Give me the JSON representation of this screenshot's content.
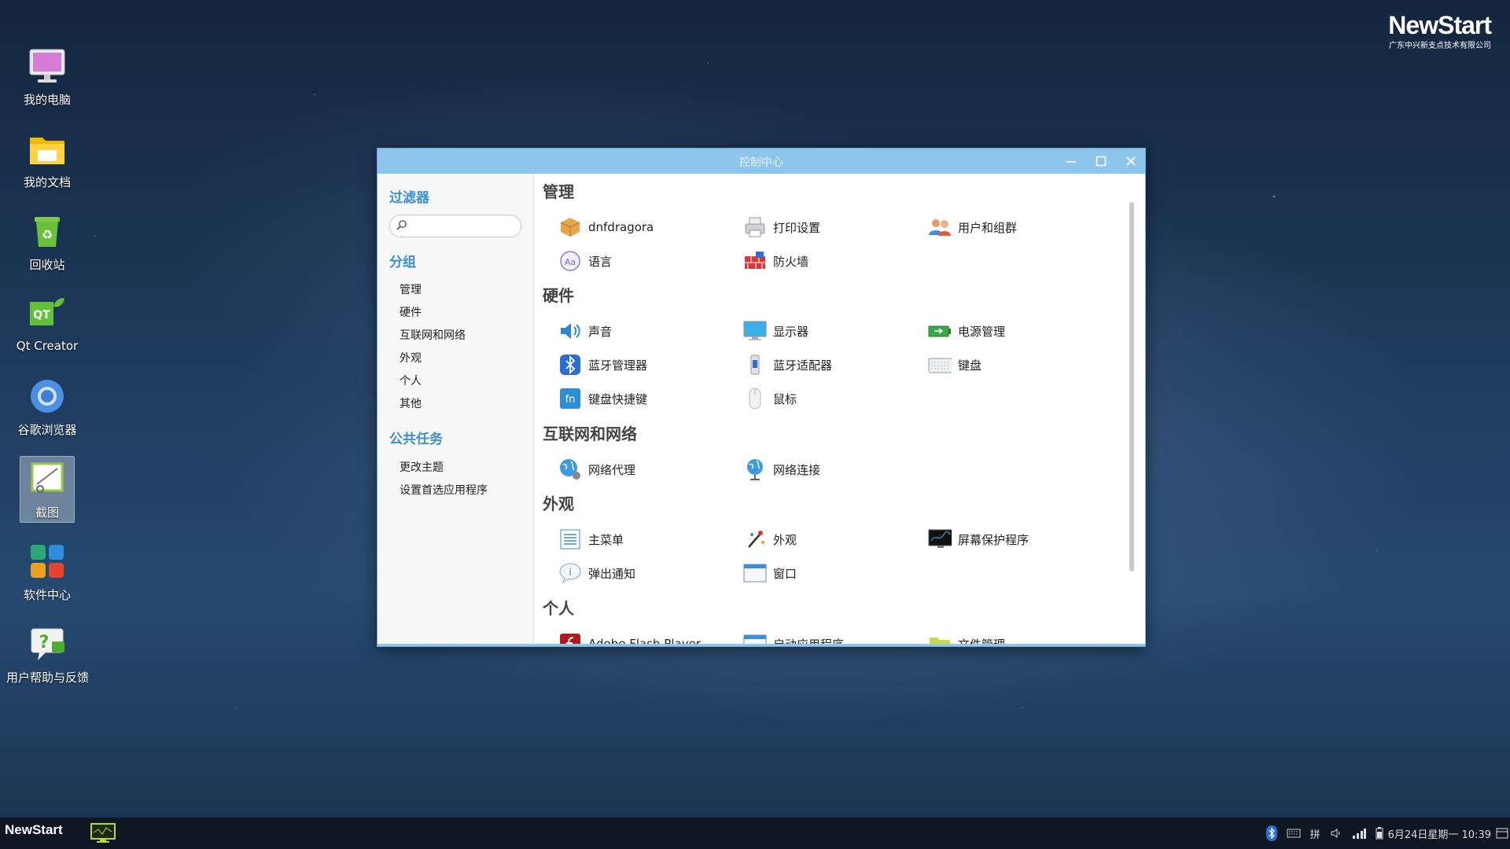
{
  "desktop": {
    "icons": [
      {
        "label": "我的电脑",
        "icon": "computer-icon"
      },
      {
        "label": "我的文档",
        "icon": "folder-icon"
      },
      {
        "label": "回收站",
        "icon": "trash-icon"
      },
      {
        "label": "Qt Creator",
        "icon": "qt-creator-icon"
      },
      {
        "label": "谷歌浏览器",
        "icon": "chrome-icon"
      },
      {
        "label": "截图",
        "icon": "screenshot-icon"
      },
      {
        "label": "软件中心",
        "icon": "software-center-icon"
      },
      {
        "label": "用户帮助与反馈",
        "icon": "help-feedback-icon"
      }
    ]
  },
  "brand": {
    "name": "NewStart",
    "subtitle": "广东中兴新支点技术有限公司"
  },
  "window": {
    "title": "控制中心",
    "sidebar": {
      "filter_title": "过滤器",
      "search_placeholder": "",
      "groups_title": "分组",
      "groups": [
        "管理",
        "硬件",
        "互联网和网络",
        "外观",
        "个人",
        "其他"
      ],
      "tasks_title": "公共任务",
      "tasks": [
        "更改主题",
        "设置首选应用程序"
      ]
    },
    "categories": [
      {
        "title": "管理",
        "items": [
          {
            "label": "dnfdragora",
            "icon": "package-icon"
          },
          {
            "label": "打印设置",
            "icon": "printer-icon"
          },
          {
            "label": "用户和组群",
            "icon": "users-icon"
          },
          {
            "label": "语言",
            "icon": "language-icon"
          },
          {
            "label": "防火墙",
            "icon": "firewall-icon"
          }
        ]
      },
      {
        "title": "硬件",
        "items": [
          {
            "label": "声音",
            "icon": "sound-icon"
          },
          {
            "label": "显示器",
            "icon": "display-icon"
          },
          {
            "label": "电源管理",
            "icon": "battery-icon"
          },
          {
            "label": "蓝牙管理器",
            "icon": "bluetooth-icon"
          },
          {
            "label": "蓝牙适配器",
            "icon": "bluetooth-adapter-icon"
          },
          {
            "label": "键盘",
            "icon": "keyboard-icon"
          },
          {
            "label": "键盘快捷键",
            "icon": "fn-key-icon"
          },
          {
            "label": "鼠标",
            "icon": "mouse-icon"
          }
        ]
      },
      {
        "title": "互联网和网络",
        "items": [
          {
            "label": "网络代理",
            "icon": "network-proxy-icon"
          },
          {
            "label": "网络连接",
            "icon": "network-connection-icon"
          }
        ]
      },
      {
        "title": "外观",
        "items": [
          {
            "label": "主菜单",
            "icon": "menu-list-icon"
          },
          {
            "label": "外观",
            "icon": "appearance-icon"
          },
          {
            "label": "屏幕保护程序",
            "icon": "screensaver-icon"
          },
          {
            "label": "弹出通知",
            "icon": "notification-icon"
          },
          {
            "label": "窗口",
            "icon": "window-icon"
          }
        ]
      },
      {
        "title": "个人",
        "items": [
          {
            "label": "Adobe Flash Player",
            "icon": "flash-icon"
          },
          {
            "label": "启动应用程序",
            "icon": "startup-apps-icon"
          },
          {
            "label": "文件管理",
            "icon": "file-manager-icon"
          }
        ]
      }
    ]
  },
  "taskbar": {
    "logo": "NewStart",
    "app_icon": "system-monitor-icon",
    "tray": {
      "input_method": "拼",
      "datetime": "6月24日星期一 10:39"
    }
  }
}
